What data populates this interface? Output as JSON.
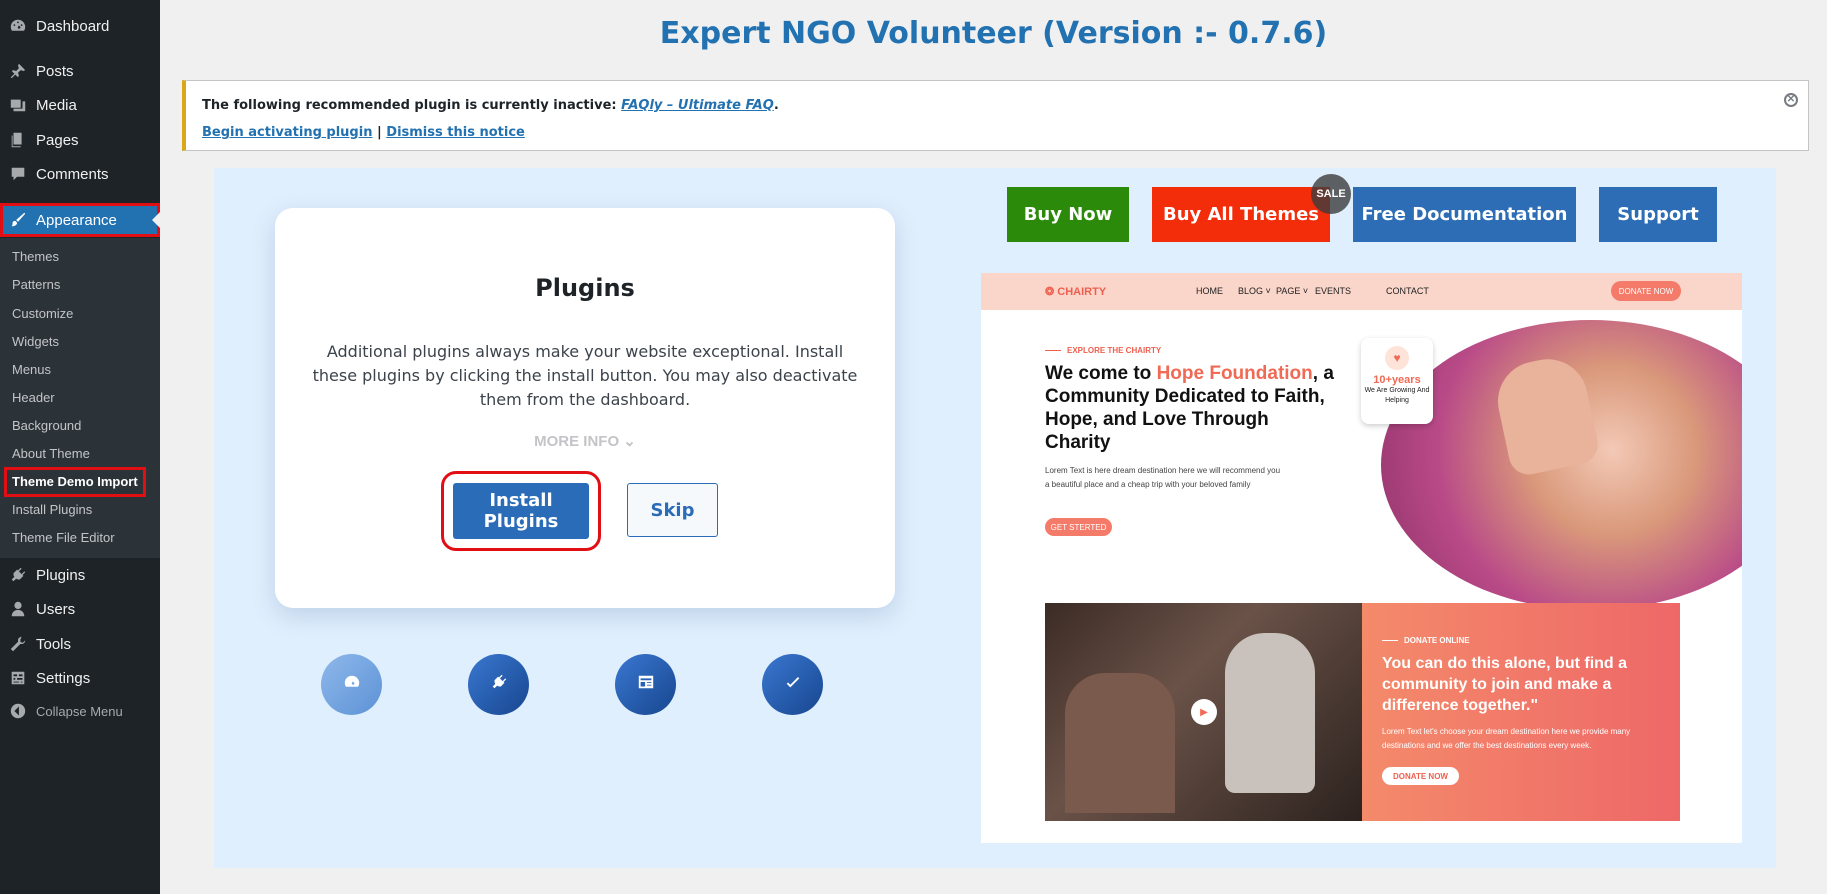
{
  "sidebar": {
    "items": [
      {
        "label": "Dashboard",
        "icon": "dashboard-icon"
      },
      {
        "label": "Posts",
        "icon": "pin-icon"
      },
      {
        "label": "Media",
        "icon": "media-icon"
      },
      {
        "label": "Pages",
        "icon": "pages-icon"
      },
      {
        "label": "Comments",
        "icon": "comment-icon"
      },
      {
        "label": "Appearance",
        "icon": "brush-icon",
        "active": true
      },
      {
        "label": "Plugins",
        "icon": "plugin-icon"
      },
      {
        "label": "Users",
        "icon": "user-icon"
      },
      {
        "label": "Tools",
        "icon": "wrench-icon"
      },
      {
        "label": "Settings",
        "icon": "settings-icon"
      }
    ],
    "collapse_label": "Collapse Menu",
    "submenu": [
      "Themes",
      "Patterns",
      "Customize",
      "Widgets",
      "Menus",
      "Header",
      "Background",
      "About Theme",
      "Theme Demo Import",
      "Install Plugins",
      "Theme File Editor"
    ],
    "submenu_current": "Theme Demo Import"
  },
  "page": {
    "title": "Expert NGO Volunteer (Version :- 0.7.6)"
  },
  "notice": {
    "text": "The following recommended plugin is currently inactive:",
    "plugin_link": "FAQly – Ultimate FAQ",
    "period": ".",
    "activate_link": "Begin activating plugin",
    "separator": "|",
    "dismiss_link": "Dismiss this notice"
  },
  "card": {
    "heading": "Plugins",
    "description": "Additional plugins always make your website exceptional. Install these plugins by clicking the install button. You may also deactivate them from the dashboard.",
    "more_info": "MORE INFO",
    "install_label": "Install Plugins",
    "skip_label": "Skip"
  },
  "steps": [
    "dashboard-icon",
    "plugin-icon",
    "widgets-icon",
    "check-icon"
  ],
  "actions": {
    "buy_now": "Buy Now",
    "buy_all": "Buy All Themes",
    "sale_badge": "SALE",
    "free_docs": "Free Documentation",
    "support": "Support",
    "colors": {
      "buy_now": "#2b8a09",
      "buy_all": "#f32c0a",
      "docs": "#2c6db5",
      "support": "#2c6db5"
    }
  },
  "preview": {
    "logo": "❂ CHAIRTY",
    "nav": [
      "HOME",
      "BLOG ˅",
      "PAGE ˅",
      "EVENTS",
      "CONTACT"
    ],
    "donate_btn": "DONATE NOW",
    "eyebrow": "EXPLORE THE CHAIRTY",
    "headline_pre": "We come to ",
    "headline_highlight": "Hope Foundation",
    "headline_post": ", a Community Dedicated to Faith, Hope, and Love Through Charity",
    "body": "Lorem Text is here dream destination here we will recommend you a beautiful place and a cheap trip with your beloved family",
    "cta": "GET STERTED",
    "badge_years": "10+years",
    "badge_sub": "We Are Growing And Helping",
    "donate_eyebrow": "DONATE ONLINE",
    "donate_headline": "You can do this alone, but find a community to join and make a difference together.\"",
    "donate_body": "Lorem Text let's choose your dream destination here we provide many destinations and we offer the best destinations every week.",
    "donate_cta": "DONATE NOW"
  }
}
